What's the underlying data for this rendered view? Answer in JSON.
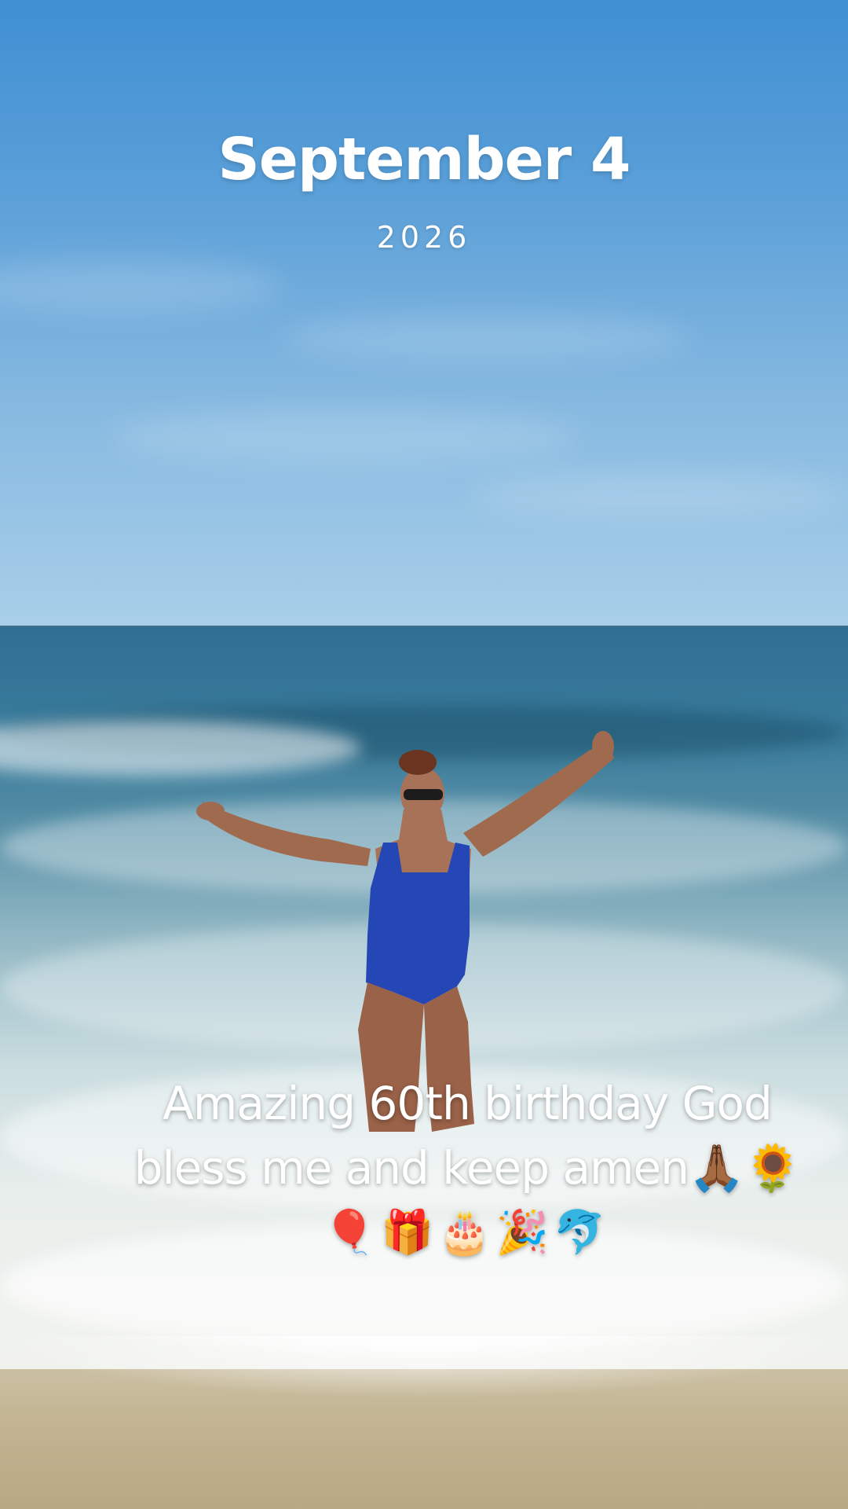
{
  "date": {
    "day": "September 4",
    "year": "2026"
  },
  "caption": {
    "line1": "Amazing 60th birthday God",
    "line2": "bless me and keep amen🙏🏾🌻",
    "line3": "🎈🎁🎂🎉🐬"
  }
}
